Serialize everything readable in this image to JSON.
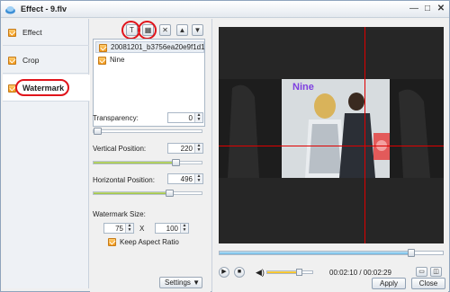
{
  "window": {
    "title": "Effect - 9.flv",
    "minimize_glyph": "—",
    "maximize_glyph": "□",
    "close_glyph": "✕"
  },
  "nav": {
    "items": [
      {
        "label": "Effect",
        "checked": true
      },
      {
        "label": "Crop",
        "checked": true
      },
      {
        "label": "Watermark",
        "checked": true,
        "active": true
      }
    ]
  },
  "toolbar": {
    "add_text_glyph": "T",
    "add_image_glyph": "▦",
    "delete_glyph": "✕",
    "move_up_glyph": "▲",
    "move_down_glyph": "▼"
  },
  "watermarks": [
    {
      "label": "20081201_b3756ea20e9f1d1",
      "checked": true,
      "selected": true
    },
    {
      "label": "Nine",
      "checked": true,
      "selected": false
    }
  ],
  "controls": {
    "transparency_label": "Transparency:",
    "transparency_value": "0",
    "transparency_fraction": 0.0,
    "vertical_label": "Vertical Position:",
    "vertical_value": "220",
    "vertical_fraction": 0.76,
    "horizontal_label": "Horizontal Position:",
    "horizontal_value": "496",
    "horizontal_fraction": 0.7,
    "size_label": "Watermark Size:",
    "width_value": "75",
    "size_sep": "X",
    "height_value": "100",
    "keep_aspect_label": "Keep Aspect Ratio",
    "keep_aspect_checked": true,
    "settings_label": "Settings ▼"
  },
  "preview": {
    "watermark_text": "Nine",
    "watermark_color": "#7e3fe0",
    "guide_color": "#e00000",
    "progress_fraction": 0.86,
    "volume_fraction": 0.7,
    "time_text": "00:02:10 / 00:02:29"
  },
  "player": {
    "play_glyph": "▶",
    "stop_glyph": "■",
    "volume_glyph": "◀)"
  },
  "buttons": {
    "apply_label": "Apply",
    "close_label": "Close"
  },
  "colors": {
    "accent_orange": "#f39a1a",
    "highlight_red": "#e0141b",
    "slider_green": "#98bd3e",
    "volume_yellow": "#f2b400"
  }
}
